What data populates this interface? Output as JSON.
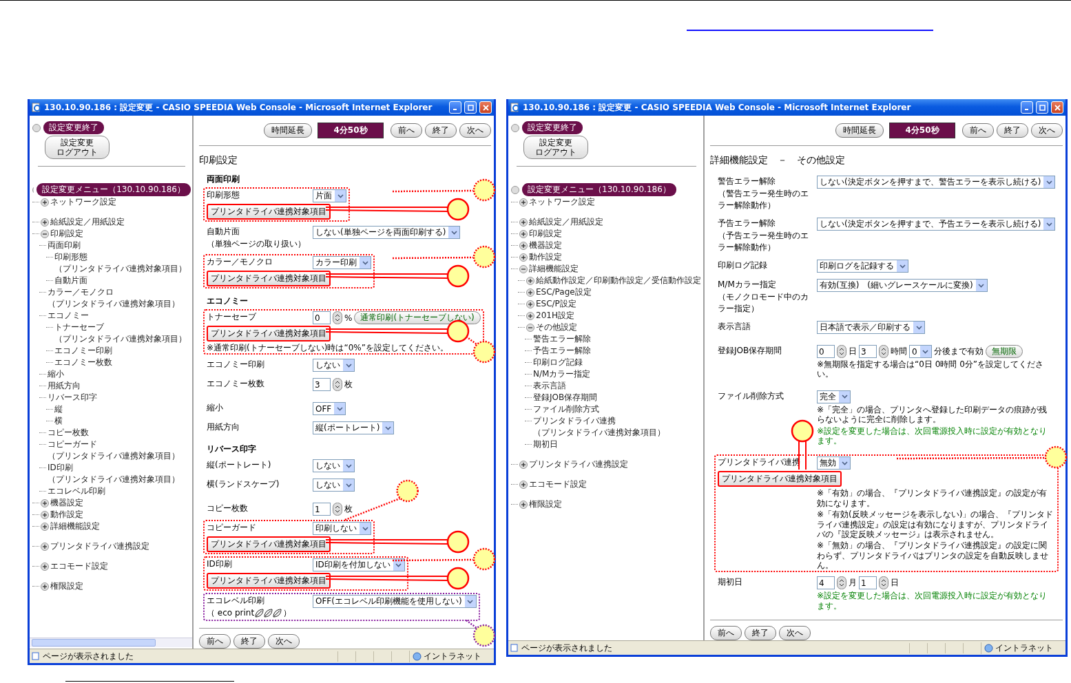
{
  "windows": [
    {
      "title": "130.10.90.186 : 設定変更 - CASIO SPEEDIA Web Console - Microsoft Internet Explorer",
      "session_label": "設定変更終了",
      "logout_lines": [
        "設定変更",
        "ログアウト"
      ],
      "menu_label": "設定変更メニュー（130.10.90.186）",
      "hscrollbar": true,
      "tree_groups": [
        [
          {
            "kind": "item",
            "label": "ネットワーク設定",
            "expanded": false
          }
        ],
        [
          {
            "kind": "item",
            "label": "給紙設定／用紙設定",
            "expanded": false
          },
          {
            "kind": "item",
            "label": "印刷設定",
            "expanded": true,
            "children": [
              {
                "kind": "item",
                "label": "両面印刷",
                "children": [
                  {
                    "kind": "item",
                    "label": "印刷形態"
                  },
                  {
                    "kind": "note",
                    "label": "（プリンタドライバ連携対象項目）"
                  },
                  {
                    "kind": "item",
                    "label": "自動片面"
                  }
                ]
              },
              {
                "kind": "item",
                "label": "カラー／モノクロ"
              },
              {
                "kind": "note",
                "label": "（プリンタドライバ連携対象項目）"
              },
              {
                "kind": "item",
                "label": "エコノミー",
                "children": [
                  {
                    "kind": "item",
                    "label": "トナーセーブ"
                  },
                  {
                    "kind": "note",
                    "label": "（プリンタドライバ連携対象項目）"
                  },
                  {
                    "kind": "item",
                    "label": "エコノミー印刷"
                  },
                  {
                    "kind": "item",
                    "label": "エコノミー枚数"
                  }
                ]
              },
              {
                "kind": "item",
                "label": "縮小"
              },
              {
                "kind": "item",
                "label": "用紙方向"
              },
              {
                "kind": "item",
                "label": "リバース印字",
                "children": [
                  {
                    "kind": "item",
                    "label": "縦"
                  },
                  {
                    "kind": "item",
                    "label": "横"
                  }
                ]
              },
              {
                "kind": "item",
                "label": "コピー枚数"
              },
              {
                "kind": "item",
                "label": "コピーガード"
              },
              {
                "kind": "note",
                "label": "（プリンタドライバ連携対象項目）"
              },
              {
                "kind": "item",
                "label": "ID印刷"
              },
              {
                "kind": "note",
                "label": "（プリンタドライバ連携対象項目）"
              },
              {
                "kind": "item",
                "label": "エコレベル印刷"
              }
            ]
          },
          {
            "kind": "item",
            "label": "機器設定",
            "expanded": false
          },
          {
            "kind": "item",
            "label": "動作設定",
            "expanded": false
          },
          {
            "kind": "item",
            "label": "詳細機能設定",
            "expanded": false
          }
        ],
        [
          {
            "kind": "item",
            "label": "プリンタドライバ連携設定",
            "expanded": false
          }
        ],
        [
          {
            "kind": "item",
            "label": "エコモード設定",
            "expanded": false
          }
        ],
        [
          {
            "kind": "item",
            "label": "権限設定",
            "expanded": false
          }
        ]
      ],
      "toolbar": {
        "extend": "時間延長",
        "timer": "4分50秒",
        "nav": [
          "前へ",
          "終了",
          "次へ"
        ]
      },
      "heading": "印刷設定",
      "row_groups": [
        [
          {
            "kind": "section",
            "label": "両面印刷"
          },
          {
            "kind": "field",
            "label": "印刷形態",
            "controls": [
              {
                "kind": "select",
                "value": "片面"
              }
            ],
            "driver_button": "プリンタドライバ連携対象項目",
            "color": "#ff0000",
            "callouts": [
              {
                "kind": "frame-right"
              },
              {
                "kind": "button-side"
              }
            ]
          },
          {
            "kind": "field",
            "label": "自動片面",
            "sublabel": "（単独ページの取り扱い）",
            "controls": [
              {
                "kind": "select",
                "value": "しない(単独ページを両面印刷する)"
              }
            ]
          },
          {
            "kind": "field",
            "label": "カラー／モノクロ",
            "controls": [
              {
                "kind": "select",
                "value": "カラー印刷"
              }
            ],
            "driver_button": "プリンタドライバ連携対象項目",
            "color": "#ff0000",
            "callouts": [
              {
                "kind": "frame-right"
              },
              {
                "kind": "button-side"
              }
            ]
          }
        ],
        [
          {
            "kind": "section",
            "label": "エコノミー"
          },
          {
            "kind": "field",
            "label": "トナーセーブ",
            "controls": [
              {
                "kind": "spin",
                "value": "0",
                "unit": "%"
              },
              {
                "kind": "button",
                "label": "通常印刷(トナーセーブしない)"
              }
            ],
            "notes": [
              {
                "kind": "plain",
                "text": "※通常印刷(トナーセーブしない)時は“0%”を設定してください。"
              }
            ],
            "driver_button": "プリンタドライバ連携対象項目",
            "color": "#ff0000",
            "callouts": [
              {
                "kind": "frame-below"
              },
              {
                "kind": "button-side"
              }
            ]
          },
          {
            "kind": "field",
            "label": "エコノミー印刷",
            "controls": [
              {
                "kind": "select",
                "value": "しない"
              }
            ]
          },
          {
            "kind": "field",
            "label": "エコノミー枚数",
            "controls": [
              {
                "kind": "spin",
                "value": "3",
                "unit": "枚"
              }
            ]
          }
        ],
        [
          {
            "kind": "field",
            "label": "縮小",
            "controls": [
              {
                "kind": "select",
                "value": "OFF"
              }
            ]
          },
          {
            "kind": "field",
            "label": "用紙方向",
            "controls": [
              {
                "kind": "select",
                "value": "縦(ポートレート)"
              }
            ]
          }
        ],
        [
          {
            "kind": "section",
            "label": "リバース印字"
          },
          {
            "kind": "field",
            "label": "縦(ポートレート)",
            "controls": [
              {
                "kind": "select",
                "value": "しない"
              }
            ]
          },
          {
            "kind": "field",
            "label": "横(ランドスケープ)",
            "controls": [
              {
                "kind": "select",
                "value": "しない"
              }
            ]
          }
        ],
        [
          {
            "kind": "field",
            "label": "コピー枚数",
            "controls": [
              {
                "kind": "spin",
                "value": "1",
                "unit": "枚"
              }
            ]
          },
          {
            "kind": "field",
            "label": "コピーガード",
            "controls": [
              {
                "kind": "select",
                "value": "印刷しない"
              }
            ],
            "driver_button": "プリンタドライバ連携対象項目",
            "color": "#ff0000",
            "callouts": [
              {
                "kind": "frame-above"
              },
              {
                "kind": "button-side"
              }
            ]
          },
          {
            "kind": "field",
            "label": "ID印刷",
            "controls": [
              {
                "kind": "select",
                "value": "ID印刷を付加しない"
              }
            ],
            "driver_button": "プリンタドライバ連携対象項目",
            "color": "#ff0000",
            "callouts": [
              {
                "kind": "frame-right"
              },
              {
                "kind": "button-side"
              }
            ]
          },
          {
            "kind": "field",
            "label": "エコレベル印刷",
            "sublabel": "（ eco print",
            "eco_mark": true,
            "sublabel_end": "）",
            "controls": [
              {
                "kind": "select",
                "value": "OFF(エコレベル印刷機能を使用しない)"
              }
            ],
            "color": "#8a1fa0",
            "callouts": [
              {
                "kind": "frame-below"
              }
            ]
          }
        ]
      ],
      "footer_nav": [
        "前へ",
        "終了",
        "次へ"
      ],
      "status": {
        "text": "ページが表示されました",
        "zone": "イントラネット"
      }
    },
    {
      "title": "130.10.90.186 : 設定変更 - CASIO SPEEDIA Web Console - Microsoft Internet Explorer",
      "session_label": "設定変更終了",
      "logout_lines": [
        "設定変更",
        "ログアウト"
      ],
      "menu_label": "設定変更メニュー（130.10.90.186）",
      "hscrollbar": false,
      "tree_groups": [
        [
          {
            "kind": "item",
            "label": "ネットワーク設定",
            "expanded": false
          }
        ],
        [
          {
            "kind": "item",
            "label": "給紙設定／用紙設定",
            "expanded": false
          },
          {
            "kind": "item",
            "label": "印刷設定",
            "expanded": false
          },
          {
            "kind": "item",
            "label": "機器設定",
            "expanded": false
          },
          {
            "kind": "item",
            "label": "動作設定",
            "expanded": false
          },
          {
            "kind": "item",
            "label": "詳細機能設定",
            "expanded": true,
            "children": [
              {
                "kind": "item",
                "label": "給紙動作設定／印刷動作設定／受信動作設定",
                "expanded": false
              },
              {
                "kind": "item",
                "label": "ESC/Page設定",
                "expanded": false
              },
              {
                "kind": "item",
                "label": "ESC/P設定",
                "expanded": false
              },
              {
                "kind": "item",
                "label": "201H設定",
                "expanded": false
              },
              {
                "kind": "item",
                "label": "その他設定",
                "expanded": true,
                "children": [
                  {
                    "kind": "item",
                    "label": "警告エラー解除"
                  },
                  {
                    "kind": "item",
                    "label": "予告エラー解除"
                  },
                  {
                    "kind": "item",
                    "label": "印刷ログ記録"
                  },
                  {
                    "kind": "item",
                    "label": "N/Mカラー指定"
                  },
                  {
                    "kind": "item",
                    "label": "表示言語"
                  },
                  {
                    "kind": "item",
                    "label": "登録JOB保存期間"
                  },
                  {
                    "kind": "item",
                    "label": "ファイル削除方式"
                  },
                  {
                    "kind": "item",
                    "label": "プリンタドライバ連携"
                  },
                  {
                    "kind": "note",
                    "label": "（プリンタドライバ連携対象項目）"
                  },
                  {
                    "kind": "item",
                    "label": "期初日"
                  }
                ]
              }
            ]
          }
        ],
        [
          {
            "kind": "item",
            "label": "プリンタドライバ連携設定",
            "expanded": false
          }
        ],
        [
          {
            "kind": "item",
            "label": "エコモード設定",
            "expanded": false
          }
        ],
        [
          {
            "kind": "item",
            "label": "権限設定",
            "expanded": false
          }
        ]
      ],
      "toolbar": {
        "extend": "時間延長",
        "timer": "4分50秒",
        "nav": [
          "前へ",
          "終了",
          "次へ"
        ]
      },
      "heading": "詳細機能設定　－　その他設定",
      "row_groups": [
        [
          {
            "kind": "field",
            "label": "警告エラー解除",
            "sublabel": "（警告エラー発生時のエラー解除動作）",
            "controls": [
              {
                "kind": "select",
                "value": "しない(決定ボタンを押すまで、警告エラーを表示し続ける)"
              }
            ]
          },
          {
            "kind": "field",
            "label": "予告エラー解除",
            "sublabel": "（予告エラー発生時のエラー解除動作）",
            "controls": [
              {
                "kind": "select",
                "value": "しない(決定ボタンを押すまで、予告エラーを表示し続ける)"
              }
            ]
          },
          {
            "kind": "field",
            "label": "印刷ログ記録",
            "controls": [
              {
                "kind": "select",
                "value": "印刷ログを記録する"
              }
            ]
          },
          {
            "kind": "field",
            "label": "M/Mカラー指定",
            "sublabel": "（モノクロモード中のカラー指定）",
            "controls": [
              {
                "kind": "select",
                "value": "有効(互換)　(細いグレースケールに変換)"
              }
            ]
          },
          {
            "kind": "field",
            "label": "表示言語",
            "controls": [
              {
                "kind": "select",
                "value": "日本語で表示／印刷する"
              }
            ]
          }
        ],
        [
          {
            "kind": "field",
            "label": "登録JOB保存期間",
            "controls": [
              {
                "kind": "spin",
                "value": "0",
                "unit": "日"
              },
              {
                "kind": "spin",
                "value": "3",
                "unit": "時間"
              },
              {
                "kind": "select",
                "value": "0"
              },
              {
                "kind": "text",
                "label": "分後まで有効"
              },
              {
                "kind": "button",
                "label": "無期限"
              }
            ],
            "notes": [
              {
                "kind": "plain",
                "text": "※無期限を指定する場合は“0日 0時間 0分”を設定してください。"
              }
            ]
          }
        ],
        [
          {
            "kind": "field",
            "label": "ファイル削除方式",
            "controls": [
              {
                "kind": "select",
                "value": "完全"
              }
            ],
            "notes": [
              {
                "kind": "plain",
                "text": "※「完全」の場合、プリンタへ登録した印刷データの痕跡が残らないように完全に削除します。"
              },
              {
                "kind": "notice",
                "text": "※設定を変更した場合は、次回電源投入時に設定が有効となります。"
              }
            ]
          }
        ],
        [
          {
            "kind": "field",
            "label": "プリンタドライバ連携",
            "controls": [
              {
                "kind": "select",
                "value": "無効"
              }
            ],
            "notes": [
              {
                "kind": "plain",
                "text": "※「有効」の場合、『プリンタドライバ連携設定』の設定が有効になります。"
              },
              {
                "kind": "plain",
                "text": "※「有効(反映メッセージを表示しない)」の場合、『プリンタドライバ連携設定』の設定は有効になりますが、プリンタドライバの『設定反映メッセージ』は表示されません。"
              },
              {
                "kind": "plain",
                "text": "※「無効」の場合、『プリンタドライバ連携設定』の設定に関わらず、プリンタドライバはプリンタの設定を自動反映しません。"
              }
            ],
            "driver_button": "プリンタドライバ連携対象項目",
            "color": "#ff0000",
            "callouts": [
              {
                "kind": "frame-right"
              },
              {
                "kind": "button-above"
              }
            ]
          },
          {
            "kind": "field",
            "label": "期初日",
            "controls": [
              {
                "kind": "spin",
                "value": "4",
                "unit": "月"
              },
              {
                "kind": "spin",
                "value": "1",
                "unit": "日"
              }
            ],
            "notes": [
              {
                "kind": "notice",
                "text": "※設定を変更した場合は、次回電源投入時に設定が有効となります。"
              }
            ]
          }
        ]
      ],
      "footer_nav": [
        "前へ",
        "終了",
        "次へ"
      ],
      "status": {
        "text": "ページが表示されました",
        "zone": "イントラネット"
      }
    }
  ]
}
